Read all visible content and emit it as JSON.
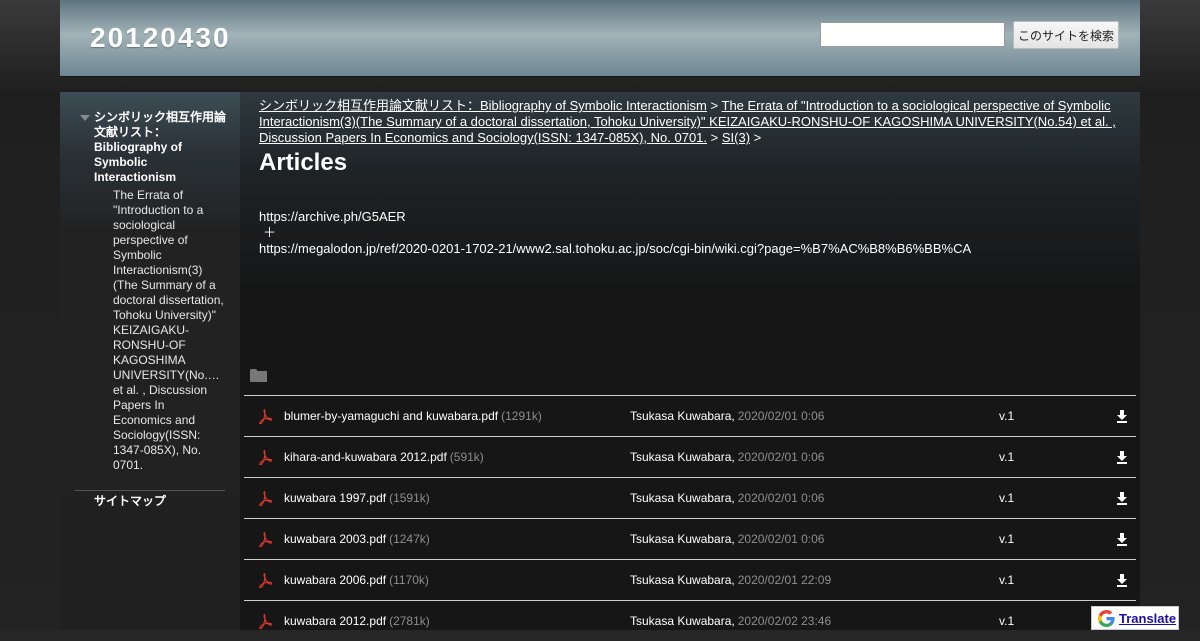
{
  "site": {
    "title": "20120430"
  },
  "search": {
    "placeholder": "",
    "button_label": "このサイトを検索"
  },
  "sidebar": {
    "top_item": "シンボリック相互作用論文献リスト：Bibliography of Symbolic Interactionism",
    "child_item": "The Errata of \"Introduction to a sociological perspective of Symbolic Interactionism(3)(The Summary of a doctoral dissertation, Tohoku University)\" KEIZAIGAKU-RONSHU-OF KAGOSHIMA UNIVERSITY(No.… et al. , Discussion Papers In Economics and Sociology(ISSN: 1347-085X), No. 0701.",
    "sitemap": "サイトマップ"
  },
  "breadcrumb": {
    "link1": "シンボリック相互作用論文献リスト：Bibliography of Symbolic Interactionism",
    "sep": ">",
    "link2": "The Errata of \"Introduction to a sociological perspective of Symbolic Interactionism(3)(The Summary of a doctoral dissertation, Tohoku University)\" KEIZAIGAKU-RONSHU-OF KAGOSHIMA UNIVERSITY(No.54) et al. , Discussion Papers In Economics and Sociology(ISSN: 1347-085X), No. 0701.",
    "link3": "SI(3)"
  },
  "page": {
    "title": "Articles",
    "line1": "https://archive.ph/G5AER",
    "line2": "＋",
    "line3": "https://megalodon.jp/ref/2020-0201-1702-21/www2.sal.tohoku.ac.jp/soc/cgi-bin/wiki.cgi?page=%B7%AC%B8%B6%BB%CA"
  },
  "files": [
    {
      "name": "blumer-by-yamaguchi and kuwabara.pdf",
      "size": "(1291k)",
      "author": "Tsukasa Kuwabara,",
      "date": "2020/02/01 0:06",
      "version": "v.1"
    },
    {
      "name": "kihara-and-kuwabara 2012.pdf",
      "size": "(591k)",
      "author": "Tsukasa Kuwabara,",
      "date": "2020/02/01 0:06",
      "version": "v.1"
    },
    {
      "name": "kuwabara 1997.pdf",
      "size": "(1591k)",
      "author": "Tsukasa Kuwabara,",
      "date": "2020/02/01 0:06",
      "version": "v.1"
    },
    {
      "name": "kuwabara 2003.pdf",
      "size": "(1247k)",
      "author": "Tsukasa Kuwabara,",
      "date": "2020/02/01 0:06",
      "version": "v.1"
    },
    {
      "name": "kuwabara 2006.pdf",
      "size": "(1170k)",
      "author": "Tsukasa Kuwabara,",
      "date": "2020/02/01 22:09",
      "version": "v.1"
    },
    {
      "name": "kuwabara 2012.pdf",
      "size": "(2781k)",
      "author": "Tsukasa Kuwabara,",
      "date": "2020/02/02 23:46",
      "version": "v.1"
    }
  ],
  "translate": {
    "label": "Translate"
  },
  "icons": {
    "file": "pdf-icon",
    "download": "download-arrow-icon",
    "folder": "folder-icon",
    "google": "google-g-icon"
  },
  "colors": {
    "header_accent": "#a2b3b8",
    "pdf_red": "#d9382c",
    "meta_gray": "#8e8e8e"
  }
}
